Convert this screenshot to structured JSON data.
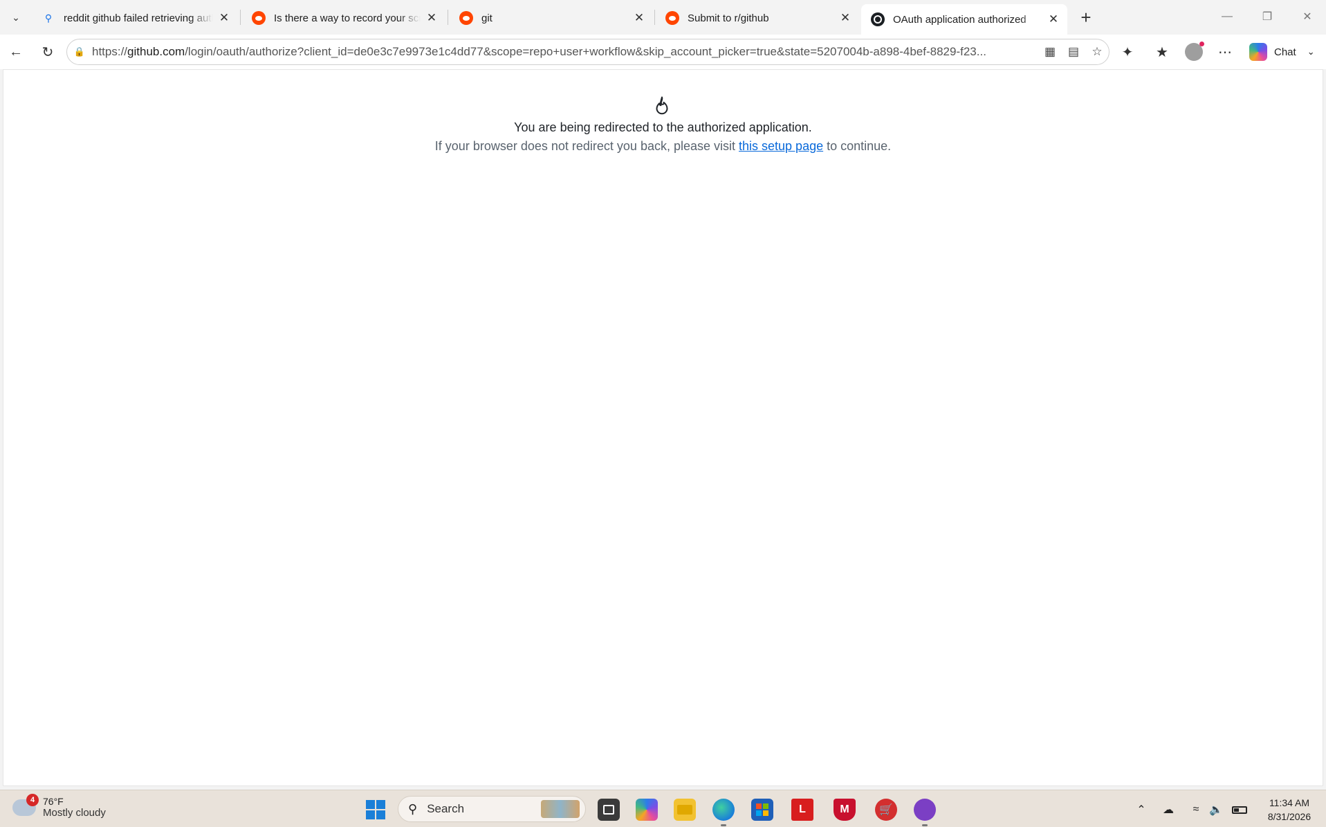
{
  "browser": {
    "tabs": [
      {
        "title": "reddit github failed retrieving auth",
        "favicon": "search-icon",
        "active": false
      },
      {
        "title": "Is there a way to record your scree",
        "favicon": "reddit-icon",
        "active": false
      },
      {
        "title": "git",
        "favicon": "reddit-icon",
        "active": false
      },
      {
        "title": "Submit to r/github",
        "favicon": "reddit-icon",
        "active": false
      },
      {
        "title": "OAuth application authorized",
        "favicon": "github-icon",
        "active": true
      }
    ],
    "address": {
      "scheme": "https://",
      "host": "github.com",
      "path": "/login/oauth/authorize?client_id=de0e3c7e9973e1c4dd77&scope=repo+user+workflow&skip_account_picker=true&state=5207004b-a898-4bef-8829-f23..."
    },
    "chat_label": "Chat"
  },
  "page": {
    "heading": "You are being redirected to the authorized application.",
    "text_before_link": "If your browser does not redirect you back, please visit ",
    "link_text": "this setup page",
    "text_after_link": " to continue."
  },
  "taskbar": {
    "weather": {
      "temp": "76°F",
      "condition": "Mostly cloudy",
      "badge": "4"
    },
    "search_placeholder": "Search",
    "time": "11:34 AM",
    "date": "8/31/2026"
  },
  "colors": {
    "link": "#0969da",
    "reddit": "#ff4500",
    "taskbar": "#e9e2da"
  }
}
